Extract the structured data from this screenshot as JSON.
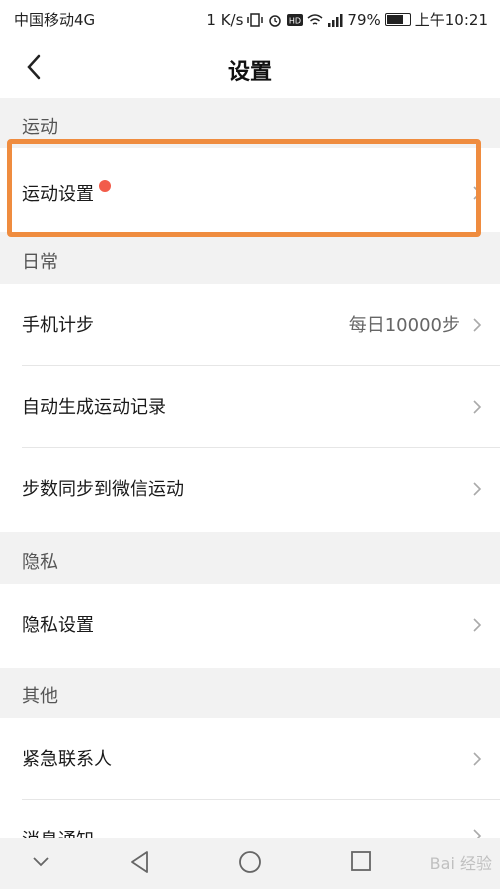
{
  "status_bar": {
    "carrier": "中国移动4G",
    "speed": "1 K/s",
    "battery": "79%",
    "time": "上午10:21",
    "icons": [
      "vibrate-icon",
      "alarm-icon",
      "hd-icon",
      "wifi-icon",
      "signal-icon",
      "battery-icon"
    ]
  },
  "header": {
    "title": "设置"
  },
  "sections": {
    "sport": {
      "title": "运动",
      "items": [
        {
          "label": "运动设置",
          "badge": "red-dot"
        }
      ]
    },
    "daily": {
      "title": "日常",
      "items": [
        {
          "label": "手机计步",
          "value": "每日10000步"
        },
        {
          "label": "自动生成运动记录"
        },
        {
          "label": "步数同步到微信运动"
        }
      ]
    },
    "privacy": {
      "title": "隐私",
      "items": [
        {
          "label": "隐私设置"
        }
      ]
    },
    "other": {
      "title": "其他",
      "items": [
        {
          "label": "紧急联系人"
        },
        {
          "label": "消息通知"
        }
      ]
    }
  },
  "bottom_nav": [
    "collapse-icon",
    "back-icon",
    "home-icon",
    "recents-icon"
  ],
  "watermark": "Bai 经验",
  "colors": {
    "highlight": "#ef8c3f",
    "badge": "#f25c4a",
    "background": "#f2f2f2"
  }
}
